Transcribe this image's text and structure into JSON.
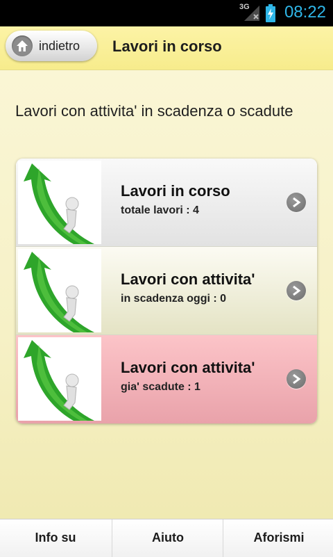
{
  "status_bar": {
    "network": "3G",
    "time": "08:22",
    "icons": [
      "signal-icon",
      "battery-charging-icon"
    ]
  },
  "header": {
    "back_label": "indietro",
    "title": "Lavori in corso"
  },
  "subtitle": "Lavori con attivita' in scadenza o scadute",
  "list": [
    {
      "title": "Lavori in corso",
      "subtitle": "totale lavori : 4"
    },
    {
      "title": "Lavori con attivita'",
      "subtitle": "in scadenza oggi : 0"
    },
    {
      "title": "Lavori con attivita'",
      "subtitle": "gia' scadute : 1"
    }
  ],
  "colors": {
    "accent_time": "#2fb6e8",
    "header_bg": "#f7ec8c",
    "overdue_row": "#f4b3b9"
  },
  "tabs": [
    "Info su",
    "Aiuto",
    "Aforismi"
  ]
}
